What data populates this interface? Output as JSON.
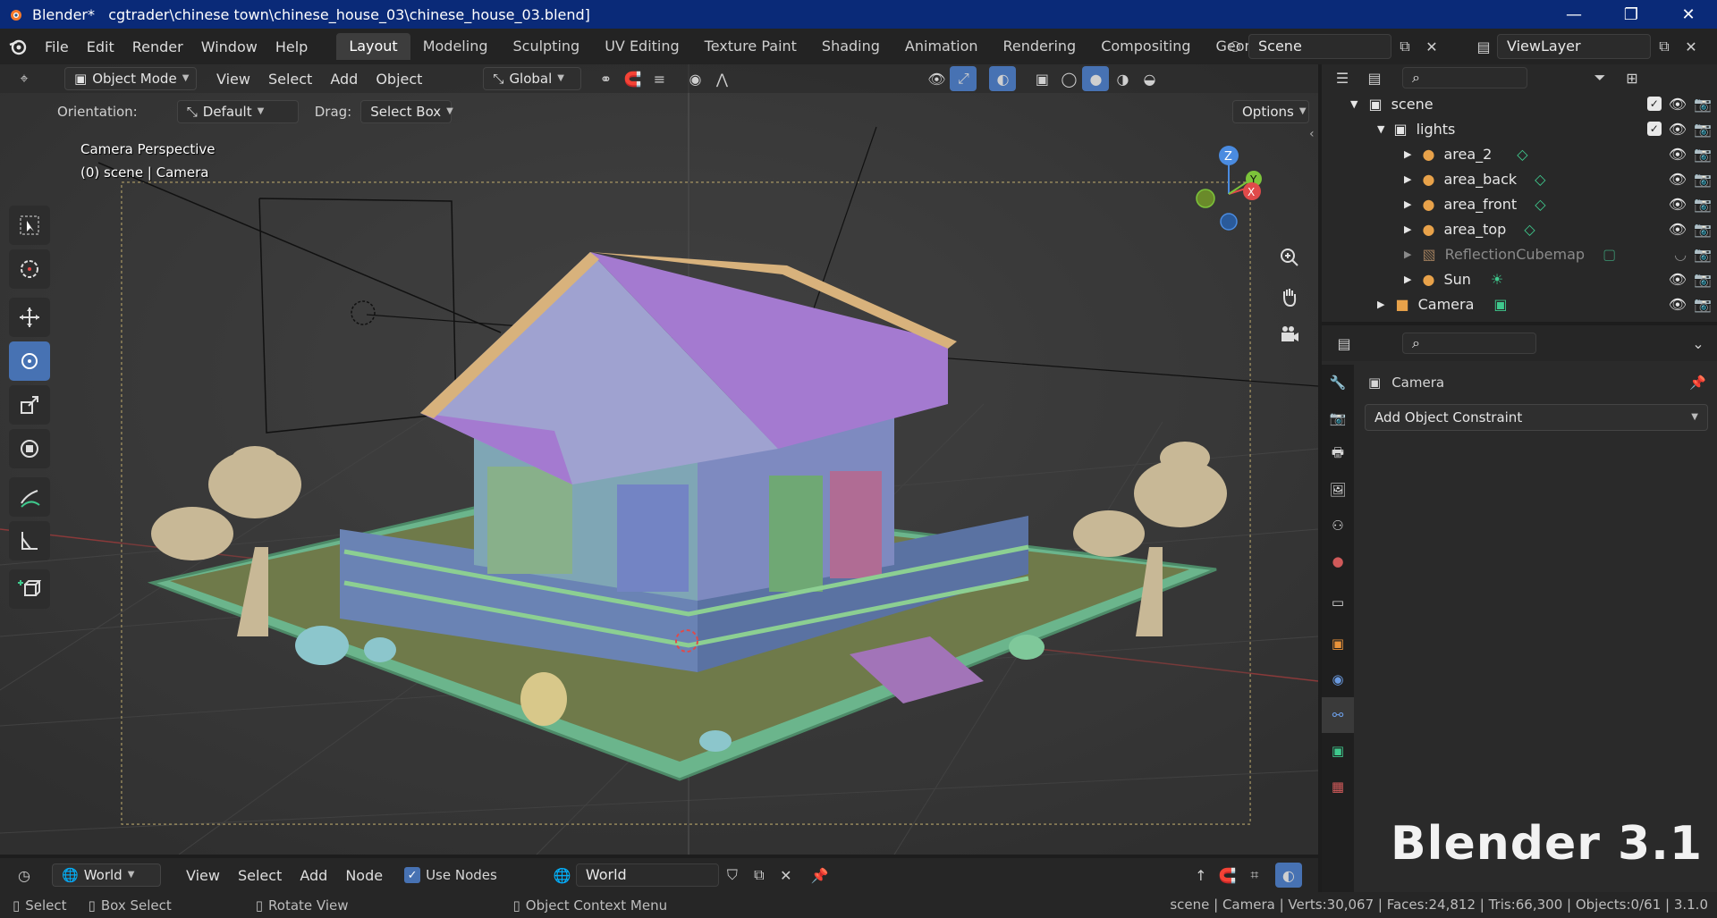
{
  "window": {
    "app_name": "Blender*",
    "file_path": "cgtrader\\chinese town\\chinese_house_03\\chinese_house_03.blend]",
    "minimize": "—",
    "maximize": "❐",
    "close": "✕"
  },
  "menu": [
    "File",
    "Edit",
    "Render",
    "Window",
    "Help"
  ],
  "workspaces": [
    "Layout",
    "Modeling",
    "Sculpting",
    "UV Editing",
    "Texture Paint",
    "Shading",
    "Animation",
    "Rendering",
    "Compositing",
    "Geometry Nod"
  ],
  "active_workspace": "Layout",
  "scene": "Scene",
  "view_layer": "ViewLayer",
  "viewport": {
    "mode": "Object Mode",
    "menus": [
      "View",
      "Select",
      "Add",
      "Object"
    ],
    "transform": "Global",
    "orientation_label": "Orientation:",
    "orientation_value": "Default",
    "drag_label": "Drag:",
    "drag_value": "Select Box",
    "options": "Options",
    "overlay_line1": "Camera Perspective",
    "overlay_line2": "(0) scene | Camera",
    "gizmo": {
      "z": "Z",
      "y": "Y",
      "x": "X"
    }
  },
  "outliner": {
    "rows": [
      {
        "name": "scene",
        "depth": 0,
        "kind": "collection"
      },
      {
        "name": "lights",
        "depth": 1,
        "kind": "collection"
      },
      {
        "name": "area_2",
        "depth": 2,
        "kind": "light"
      },
      {
        "name": "area_back",
        "depth": 2,
        "kind": "light"
      },
      {
        "name": "area_front",
        "depth": 2,
        "kind": "light"
      },
      {
        "name": "area_top",
        "depth": 2,
        "kind": "light"
      },
      {
        "name": "ReflectionCubemap",
        "depth": 2,
        "kind": "probe"
      },
      {
        "name": "Sun",
        "depth": 2,
        "kind": "sun"
      },
      {
        "name": "Camera",
        "depth": 1,
        "kind": "camera"
      }
    ]
  },
  "properties": {
    "object_name": "Camera",
    "add_constraint": "Add Object Constraint"
  },
  "node_editor": {
    "world_type": "World",
    "menus": [
      "View",
      "Select",
      "Add",
      "Node"
    ],
    "use_nodes": "Use Nodes",
    "world_name": "World"
  },
  "status": {
    "select": "Select",
    "box_select": "Box Select",
    "rotate_view": "Rotate View",
    "context_menu": "Object Context Menu",
    "stats": "scene | Camera | Verts:30,067 | Faces:24,812 | Tris:66,300 | Objects:0/61 | 3.1.0"
  },
  "watermark": "Blender 3.1",
  "colors": {
    "title_bar": "#0a2a78",
    "accent": "#4772b3",
    "light_icon": "#e8a24a",
    "green_icon": "#3fc98d"
  }
}
